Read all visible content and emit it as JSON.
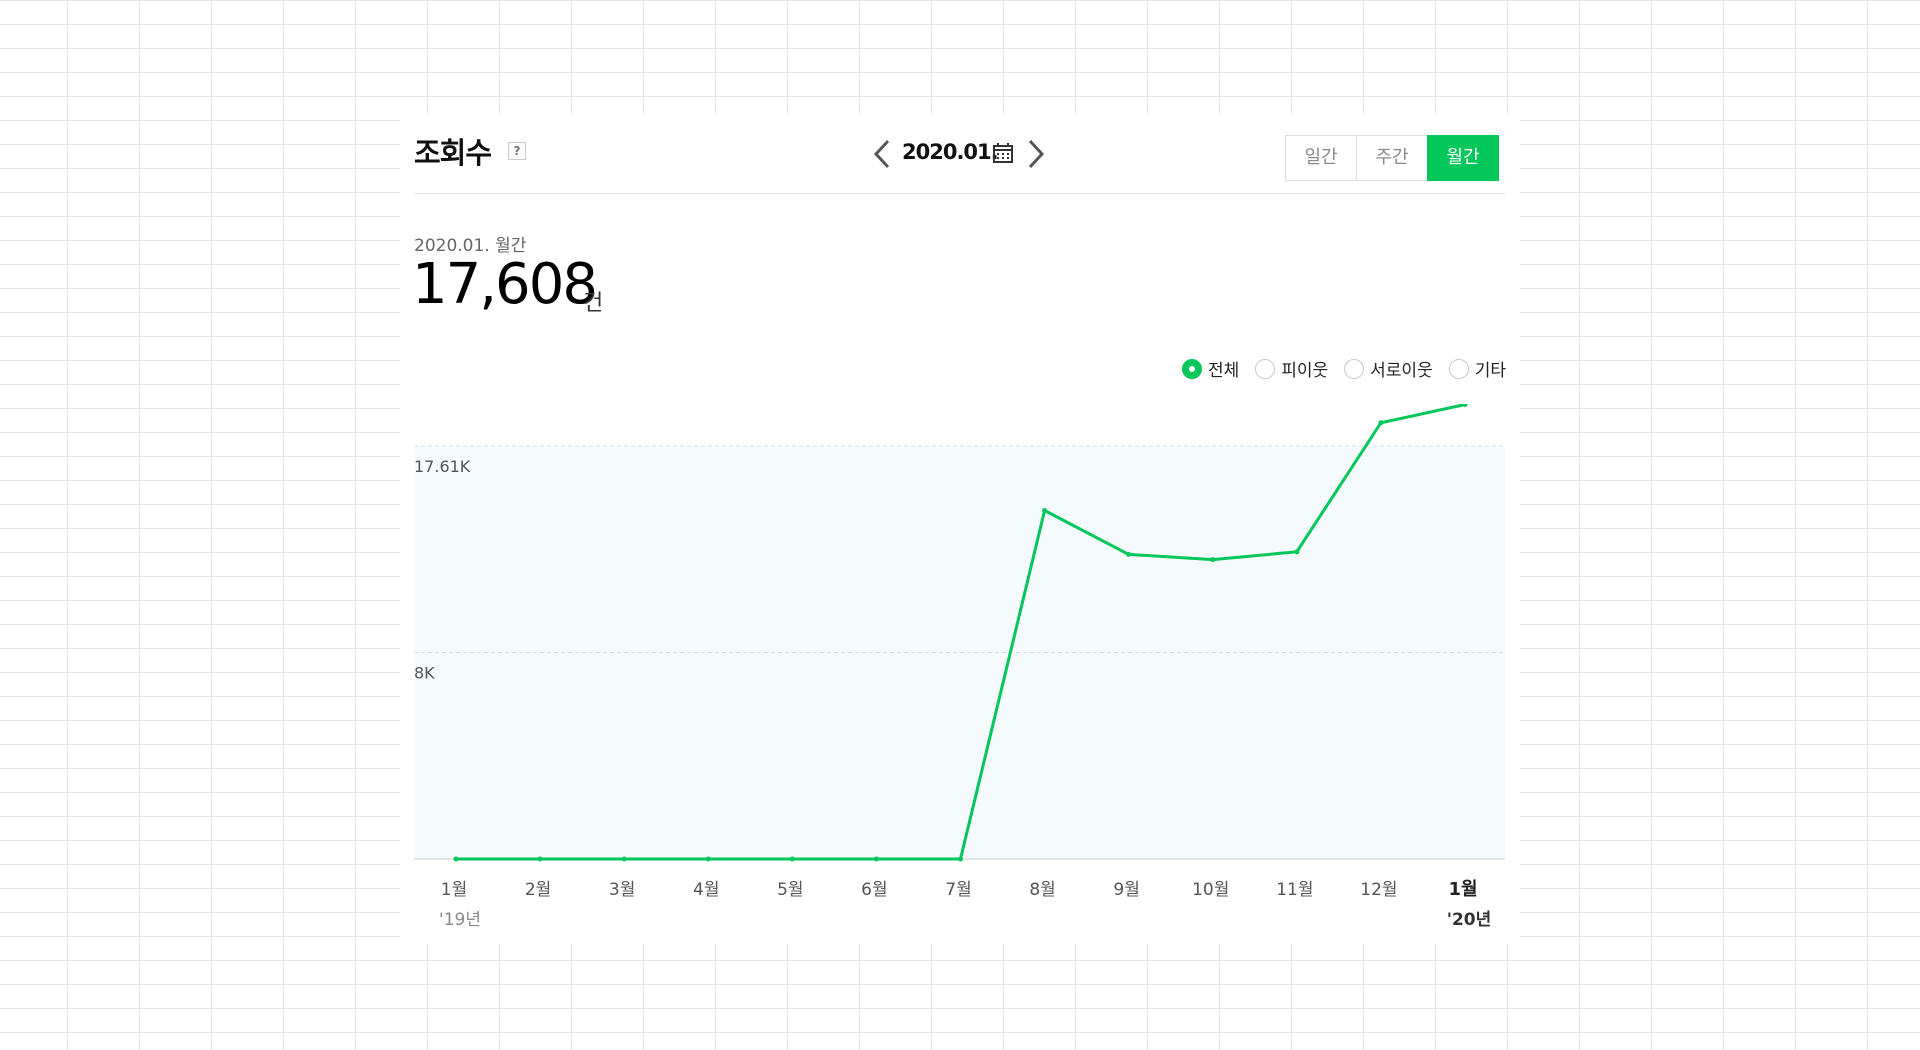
{
  "panel": {
    "title": "조회수",
    "help_icon": "help-question-icon"
  },
  "date_nav": {
    "label": "2020.01.",
    "prev_icon": "chevron-left-icon",
    "next_icon": "chevron-right-icon",
    "calendar_icon": "calendar-icon"
  },
  "period_tabs": [
    {
      "label": "일간",
      "active": false
    },
    {
      "label": "주간",
      "active": false
    },
    {
      "label": "월간",
      "active": true
    }
  ],
  "summary": {
    "period": "2020.01. 월간",
    "value": "17,608",
    "unit": "건"
  },
  "filters": [
    {
      "label": "전체",
      "selected": true
    },
    {
      "label": "피이웃",
      "selected": false
    },
    {
      "label": "서로이웃",
      "selected": false
    },
    {
      "label": "기타",
      "selected": false
    }
  ],
  "colors": {
    "accent": "#03c75a",
    "plot_background": "#f5fafd",
    "grid": "#d9dee3"
  },
  "chart_data": {
    "type": "line",
    "categories": [
      "1월",
      "2월",
      "3월",
      "4월",
      "5월",
      "6월",
      "7월",
      "8월",
      "9월",
      "10월",
      "11월",
      "12월",
      "1월"
    ],
    "year_labels": [
      "'19년",
      "",
      "",
      "",
      "",
      "",
      "",
      "",
      "",
      "",
      "",
      "",
      "'20년"
    ],
    "highlight_index": 12,
    "series": [
      {
        "values": [
          0,
          0,
          0,
          0,
          0,
          0,
          0,
          13500,
          11800,
          11600,
          11900,
          16900,
          17608
        ]
      }
    ],
    "y_ticks": [
      {
        "value": 8000,
        "label": "8K"
      },
      {
        "value": 15600,
        "label": "17.61K"
      }
    ],
    "ylim": [
      0,
      16000
    ],
    "grid": true,
    "legend": "none"
  }
}
